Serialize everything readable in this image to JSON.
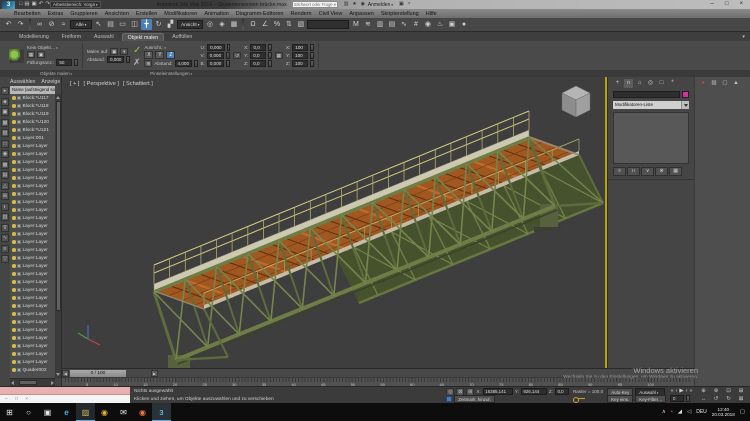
{
  "window": {
    "app_glyph": "3",
    "qat_icons": [
      {
        "g": "□",
        "n": "new-scene-icon"
      },
      {
        "g": "▤",
        "n": "open-file-icon"
      },
      {
        "g": "▣",
        "n": "save-file-icon"
      },
      {
        "g": "↶",
        "n": "undo-icon"
      },
      {
        "g": "↷",
        "n": "redo-icon"
      }
    ],
    "workspace_label": "Arbeitsbereich: Vorga",
    "title": "Autodesk 3ds Max 2016 – Studentenversion   brücke.max",
    "search_placeholder": "Stichwort oder Frage eingeben",
    "pre_icons": [
      {
        "g": "▥",
        "n": "search-options-icon"
      },
      {
        "g": "★",
        "n": "favorites-icon"
      },
      {
        "g": "◉",
        "n": "profile-icon"
      }
    ],
    "signin_label": "Anmelden",
    "post_icons": [
      {
        "g": "▣",
        "n": "a360-icon"
      },
      {
        "g": "?",
        "n": "help-icon"
      }
    ],
    "min_glyph": "–",
    "max_glyph": "□",
    "close_glyph": "×"
  },
  "menubar": [
    "Bearbeiten",
    "Extras",
    "Gruppieren",
    "Ansichten",
    "Erstellen",
    "Modifikatoren",
    "Animation",
    "Diagramm-Editoren",
    "Rendern",
    "Civil View",
    "Anpassen",
    "Skripterstellung",
    "Hilfe"
  ],
  "toolbar": {
    "items": [
      {
        "g": "↶",
        "n": "undo-icon"
      },
      {
        "g": "↷",
        "n": "redo-icon"
      },
      {
        "g": "",
        "n": "separator",
        "c": "sep"
      },
      {
        "g": "∞",
        "n": "select-and-link-icon"
      },
      {
        "g": "⊘",
        "n": "unlink-selection-icon"
      },
      {
        "g": "≈",
        "n": "bind-to-spacewarp-icon"
      },
      {
        "g": "Alle",
        "n": "selection-filter-dropdown",
        "c": "dd"
      },
      {
        "g": "↖",
        "n": "select-object-icon"
      },
      {
        "g": "▤",
        "n": "select-by-name-icon"
      },
      {
        "g": "▭",
        "n": "selection-region-icon"
      },
      {
        "g": "◫",
        "n": "window-crossing-icon"
      },
      {
        "g": "╋",
        "n": "select-and-move-icon",
        "c": "hl"
      },
      {
        "g": "↻",
        "n": "select-and-rotate-icon"
      },
      {
        "g": "▞",
        "n": "select-and-scale-icon"
      },
      {
        "g": "Ansicht",
        "n": "reference-coordinate-dropdown",
        "c": "dd"
      },
      {
        "g": "◎",
        "n": "use-pivot-center-icon"
      },
      {
        "g": "◈",
        "n": "select-and-manipulate-icon"
      },
      {
        "g": "▦",
        "n": "keyboard-override-icon"
      },
      {
        "g": "",
        "n": "separator",
        "c": "sep"
      },
      {
        "g": "Ω",
        "n": "snap-toggle-3d-icon"
      },
      {
        "g": "∠",
        "n": "angle-snap-icon"
      },
      {
        "g": "%",
        "n": "percent-snap-icon"
      },
      {
        "g": "⇅",
        "n": "spinner-snap-icon"
      },
      {
        "g": "▧",
        "n": "edit-named-selections-icon"
      },
      {
        "g": "",
        "n": "named-selection-dropdown",
        "c": "ddw"
      },
      {
        "g": "M",
        "n": "mirror-icon"
      },
      {
        "g": "≋",
        "n": "align-icon"
      },
      {
        "g": "▥",
        "n": "toggle-scene-explorer-icon"
      },
      {
        "g": "▤",
        "n": "layer-manager-icon"
      },
      {
        "g": "∿",
        "n": "curve-editor-icon"
      },
      {
        "g": "#",
        "n": "schematic-view-icon"
      },
      {
        "g": "◉",
        "n": "material-editor-icon"
      },
      {
        "g": "♨",
        "n": "render-setup-icon"
      },
      {
        "g": "▣",
        "n": "rendered-frame-icon"
      },
      {
        "g": "●",
        "n": "render-production-icon"
      }
    ]
  },
  "ribbon": {
    "tabs": [
      {
        "label": "Modellierung"
      },
      {
        "label": "Freiform"
      },
      {
        "label": "Auswahl"
      },
      {
        "label": "Objekt malen",
        "c": "active"
      },
      {
        "label": "Auffüllen"
      }
    ],
    "overflow_glyph": "▾",
    "no_object": "Kein Objekt…",
    "paint_mini": [
      {
        "g": "▦",
        "n": "paint-fill-icon"
      },
      {
        "g": "▣",
        "n": "paint-object-icon"
      }
    ],
    "fill_label": "Füllungsanz.:",
    "fill_value": "50",
    "paint_on_label": "Malen auf:",
    "paint_on_icons": [
      {
        "g": "▣",
        "n": "paint-on-surface-icon"
      },
      {
        "g": "▾",
        "n": "paint-on-dropdown-icon"
      }
    ],
    "spacing_label": "Abstand:",
    "spacing_value": "0,000",
    "check_glyph": "✓",
    "cross_glyph": "✗",
    "align_label": "Ausricht.:",
    "axis_buttons": [
      {
        "label": "X"
      },
      {
        "label": "Y"
      },
      {
        "label": "Z",
        "c": "zhl"
      }
    ],
    "offset_icon": "⊞",
    "offset_label": "Abstand:",
    "offset_value": "4,000",
    "uvb_fields": [
      {
        "k": "U:",
        "v": "0,000"
      },
      {
        "k": "V:",
        "v": "0,000"
      },
      {
        "k": "B:",
        "v": "0,000"
      }
    ],
    "rotate_icon": "↺",
    "rot_fields": [
      {
        "k": "X:",
        "v": "0,0"
      },
      {
        "k": "Y:",
        "v": "0,0"
      },
      {
        "k": "Z:",
        "v": "0,0"
      }
    ],
    "scale_icon": "▦",
    "scale_fields": [
      {
        "k": "X:",
        "v": "100"
      },
      {
        "k": "Y:",
        "v": "100"
      },
      {
        "k": "Z:",
        "v": "100"
      }
    ],
    "footer_group1": "Objekte malen",
    "footer_group2": "Pinseleinstellungen"
  },
  "explorer": {
    "menus": [
      "Auswählen",
      "Anzeige"
    ],
    "header": "Name (aufsteigend sortiert)",
    "side_icons": [
      "▸",
      "◈",
      "▣",
      "▩",
      "▨",
      "□",
      "◉",
      "▦",
      "▤",
      "△",
      "⊞",
      "◐",
      "▥",
      "∇",
      "∿",
      "≡",
      "▽"
    ],
    "items": [
      "Block:*U117",
      "Block:*U118",
      "Block:*U119",
      "Block:*U120",
      "Block:*U121",
      "Layer:001",
      "Layer:Layer",
      "Layer:Layer",
      "Layer:Layer",
      "Layer:Layer",
      "Layer:Layer",
      "Layer:Layer",
      "Layer:Layer",
      "Layer:Layer",
      "Layer:Layer",
      "Layer:Layer",
      "Layer:Layer",
      "Layer:Layer",
      "Layer:Layer",
      "Layer:Layer",
      "Layer:Layer",
      "Layer:Layer",
      "Layer:Layer",
      "Layer:Layer",
      "Layer:Layer",
      "Layer:Layer",
      "Layer:Layer",
      "Layer:Layer",
      "Layer:Layer",
      "Layer:Layer",
      "Layer:Layer",
      "Layer:Layer",
      "Layer:Layer",
      "Layer:Layer",
      "Quader002"
    ]
  },
  "viewport": {
    "plus": "[ + ]",
    "view": "[ Perspektive ]",
    "shading": "[ Schattiert ]"
  },
  "command": {
    "tabs": [
      {
        "g": "+",
        "n": "create-tab-icon"
      },
      {
        "g": "∩",
        "n": "modify-tab-icon",
        "c": "on"
      },
      {
        "g": "⌂",
        "n": "hierarchy-tab-icon"
      },
      {
        "g": "◎",
        "n": "motion-tab-icon"
      },
      {
        "g": "□",
        "n": "display-tab-icon"
      },
      {
        "g": "*",
        "n": "utilities-tab-icon"
      }
    ],
    "modifier_list_label": "Modifikatoren-Liste",
    "stack_buttons": [
      {
        "g": "≡",
        "n": "pin-stack-icon"
      },
      {
        "g": "II",
        "n": "show-end-result-icon"
      },
      {
        "g": "∨",
        "n": "make-unique-icon"
      },
      {
        "g": "⊗",
        "n": "remove-modifier-icon"
      },
      {
        "g": "▦",
        "n": "configure-modifier-sets-icon"
      }
    ]
  },
  "dock": {
    "icons": [
      {
        "g": "●",
        "n": "record-icon",
        "c": "red"
      },
      {
        "g": "▨",
        "n": "grid-icon"
      },
      {
        "g": "▢",
        "n": "box-icon"
      },
      {
        "g": "▲",
        "n": "tool-icon"
      }
    ]
  },
  "timeline": {
    "left_glyph": "◀",
    "slider_label": "0 / 100",
    "right_glyph": "▶",
    "ticks": [
      "5",
      "10",
      "15",
      "20",
      "25",
      "30",
      "35",
      "40",
      "45",
      "50",
      "55",
      "60",
      "65",
      "70",
      "75",
      "80",
      "85",
      "90",
      "95",
      "100"
    ]
  },
  "watermark": {
    "line1": "Windows aktivieren",
    "line2": "Wechseln Sie zu den Einstellungen, um Windows zu aktivieren."
  },
  "status": {
    "listener_glyphs": "–  □  ×",
    "selection": "Nichts ausgewählt",
    "prompt": "Klicken und ziehen, um Objekte auszuwählen und zu verschieben",
    "mode_icons": [
      {
        "g": "◎",
        "n": "isolate-selection-icon"
      },
      {
        "g": "⊠",
        "n": "selection-lock-icon"
      },
      {
        "g": "⊞",
        "n": "absolute-mode-icon"
      }
    ],
    "x_label": "X:",
    "x_value": "16385,141",
    "y_label": "Y:",
    "y_value": "926,144",
    "z_label": "Z:",
    "z_value": "0,0",
    "grid_label": "Raster = 100,0",
    "time_tag": "Zeitmark. hinzuf.",
    "autokey": "Auto-Key",
    "sel_set": "Auswahl",
    "set_key": "Key eins.",
    "key_filter": "Key-Filter…",
    "frame": "0",
    "play_icons": [
      {
        "g": "«",
        "n": "go-start-icon"
      },
      {
        "g": "‹",
        "n": "prev-frame-icon"
      },
      {
        "g": "▶",
        "n": "play-icon"
      },
      {
        "g": "›",
        "n": "next-frame-icon"
      },
      {
        "g": "»",
        "n": "go-end-icon"
      }
    ],
    "nav_icons": [
      {
        "g": "⊕",
        "n": "zoom-icon"
      },
      {
        "g": "⊛",
        "n": "zoom-all-icon"
      },
      {
        "g": "⊡",
        "n": "zoom-extents-icon"
      },
      {
        "g": "⊞",
        "n": "zoom-region-icon"
      },
      {
        "g": "↔",
        "n": "pan-icon"
      },
      {
        "g": "↺",
        "n": "walk-through-icon"
      },
      {
        "g": "↻",
        "n": "orbit-icon"
      },
      {
        "g": "⊠",
        "n": "maximize-viewport-icon"
      }
    ]
  },
  "taskbar": {
    "apps": [
      {
        "g": "⊞",
        "n": "start-button",
        "c": "win"
      },
      {
        "g": "○",
        "n": "taskbar-search-icon",
        "c": ""
      },
      {
        "g": "▣",
        "n": "task-view-icon",
        "c": ""
      },
      {
        "g": "e",
        "n": "edge-icon",
        "c": "edge"
      },
      {
        "g": "▨",
        "n": "file-explorer-icon",
        "c": "folder act"
      },
      {
        "g": "◉",
        "n": "chrome-icon",
        "c": "chrome"
      },
      {
        "g": "✉",
        "n": "mail-icon",
        "c": ""
      },
      {
        "g": "◉",
        "n": "firefox-icon",
        "c": "firefox"
      },
      {
        "g": "3",
        "n": "max-icon",
        "c": "max"
      }
    ],
    "tray": [
      {
        "g": "∧",
        "n": "hidden-icons-chevron"
      },
      {
        "g": "▪",
        "n": "alert-icon",
        "c": "red"
      },
      {
        "g": "◢",
        "n": "network-icon"
      },
      {
        "g": "◁",
        "n": "volume-icon"
      }
    ],
    "lang": "DEU",
    "time": "12:40",
    "date": "20.03.2018",
    "action_glyph": "▢"
  }
}
